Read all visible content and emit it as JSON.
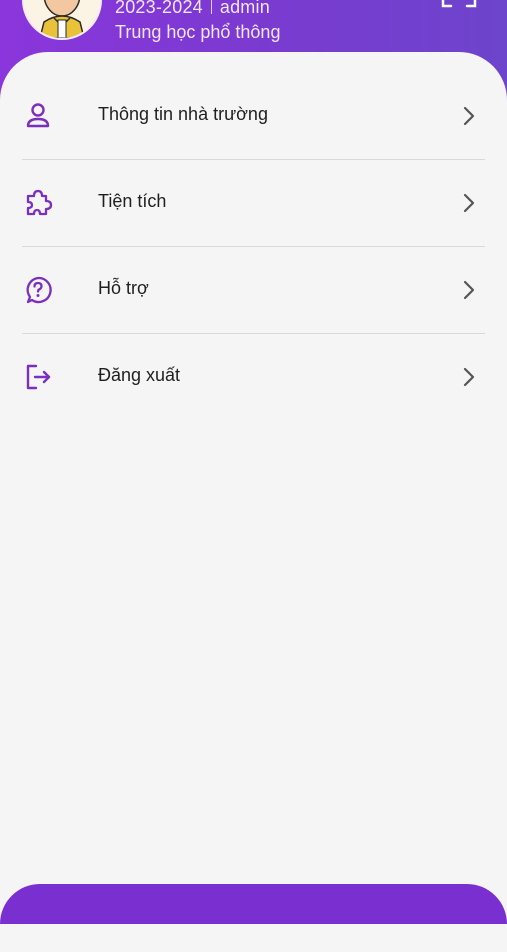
{
  "header": {
    "school_year": "2023-2024",
    "username": "admin",
    "school_level": "Trung học phổ thông"
  },
  "menu": {
    "items": [
      {
        "label": "Thông tin nhà trường",
        "icon": "user-icon"
      },
      {
        "label": "Tiện tích",
        "icon": "puzzle-icon"
      },
      {
        "label": "Hỗ trợ",
        "icon": "help-icon"
      },
      {
        "label": "Đăng xuất",
        "icon": "logout-icon"
      }
    ]
  },
  "colors": {
    "accent": "#7a2fd0",
    "icon": "#7b2fbf",
    "chevron": "#555555",
    "background": "#f5f5f5"
  }
}
